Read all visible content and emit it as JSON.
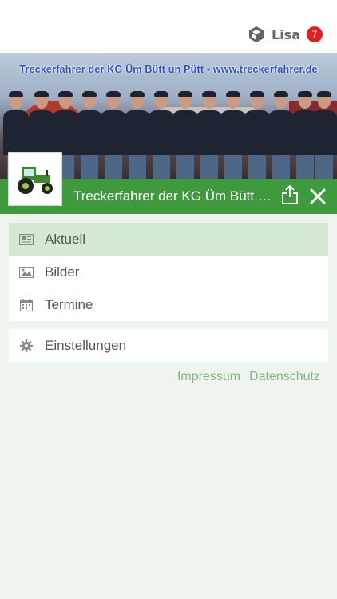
{
  "topbar": {
    "user_name": "Lisa",
    "notification_count": "7",
    "app_logo_icon": "hexagon-logo-icon"
  },
  "hero": {
    "banner_text": "Treckerfahrer der KG Üm Bütt un Pütt  -  www.treckerfahrer.de"
  },
  "club": {
    "title": "Treckerfahrer der KG Üm Bütt un Pütt",
    "logo_icon": "tractor-icon"
  },
  "menu": {
    "items": [
      {
        "label": "Aktuell",
        "icon": "newspaper-icon",
        "active": true
      },
      {
        "label": "Bilder",
        "icon": "image-icon",
        "active": false
      },
      {
        "label": "Termine",
        "icon": "calendar-icon",
        "active": false
      }
    ],
    "settings_label": "Einstellungen",
    "settings_icon": "gear-icon"
  },
  "footer": {
    "impressum": "Impressum",
    "datenschutz": "Datenschutz"
  },
  "colors": {
    "brand_green": "#3f9a3d",
    "active_bg": "#d4e8d3",
    "page_bg": "#eef5ee",
    "badge_red": "#e02020",
    "link_green": "#86b386"
  }
}
